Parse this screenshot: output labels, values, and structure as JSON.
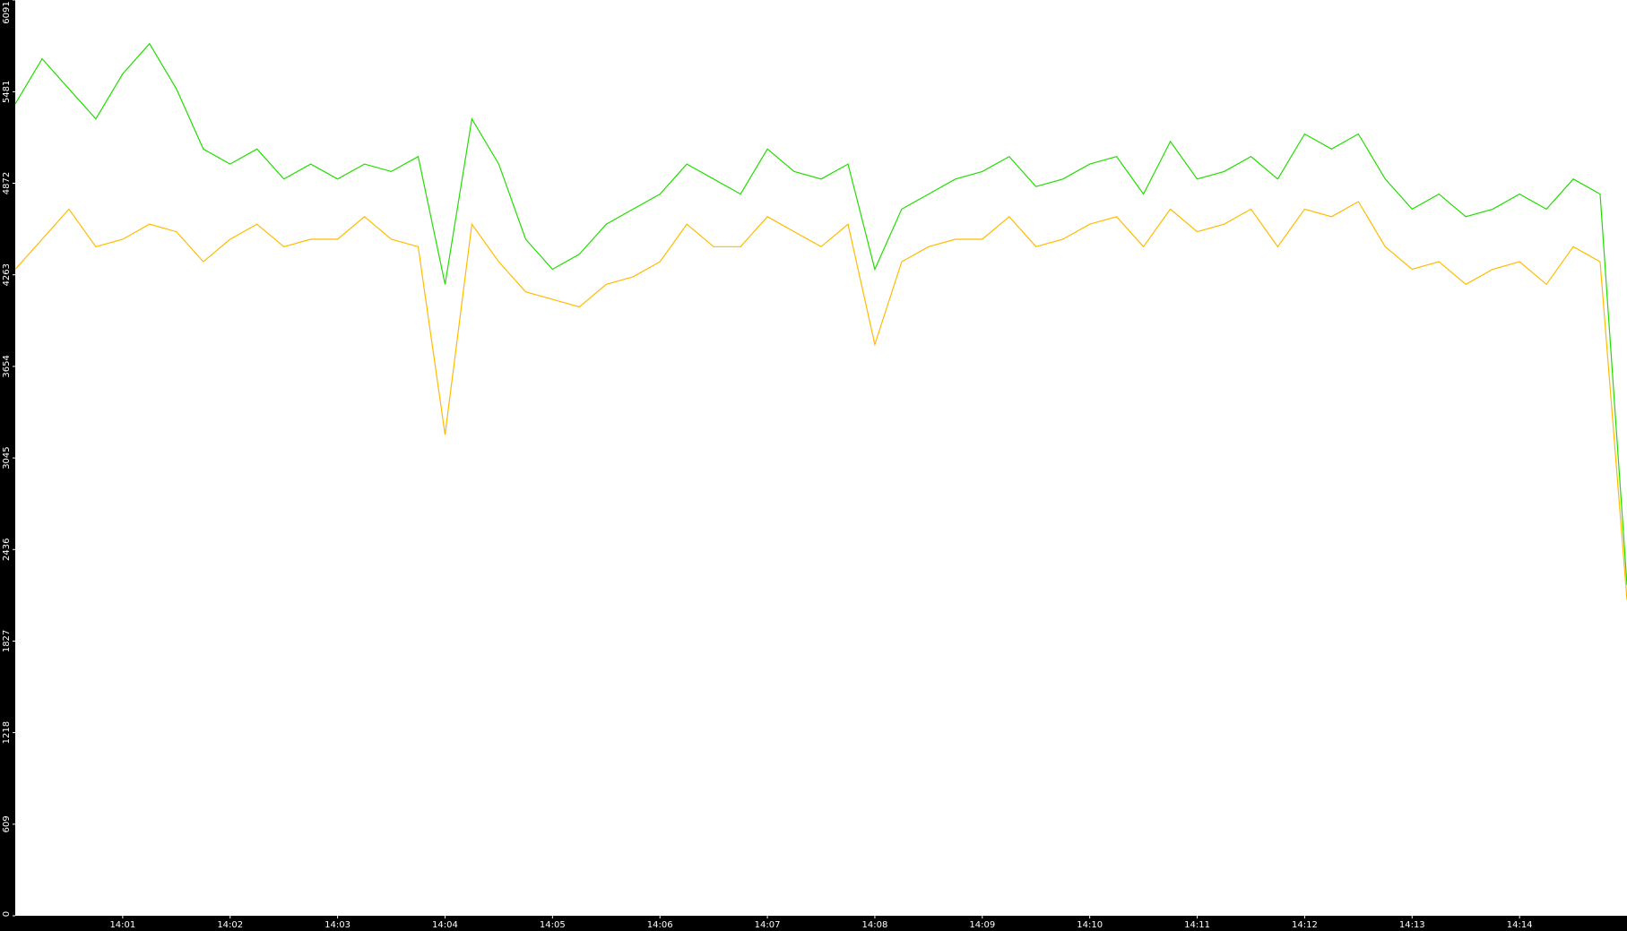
{
  "chart_data": {
    "type": "line",
    "title": "",
    "xlabel": "",
    "ylabel": "",
    "grid": false,
    "legend": "none",
    "ylim": [
      0,
      6091
    ],
    "xlim": [
      "14:00:00",
      "14:15:00"
    ],
    "y_ticks": [
      "0",
      "609",
      "1218",
      "1827",
      "2436",
      "3045",
      "3654",
      "4263",
      "4872",
      "5481",
      "6091"
    ],
    "x_ticks": [
      {
        "time": "14:01",
        "label": "14:01"
      },
      {
        "time": "14:02",
        "label": "14:02"
      },
      {
        "time": "14:03",
        "label": "14:03"
      },
      {
        "time": "14:04",
        "label": "14:04"
      },
      {
        "time": "14:05",
        "label": "14:05"
      },
      {
        "time": "14:06",
        "label": "14:06"
      },
      {
        "time": "14:07",
        "label": "14:07"
      },
      {
        "time": "14:08",
        "label": "14:08"
      },
      {
        "time": "14:09",
        "label": "14:09"
      },
      {
        "time": "14:10",
        "label": "14:10"
      },
      {
        "time": "14:11",
        "label": "14:11"
      },
      {
        "time": "14:12",
        "label": "14:12"
      },
      {
        "time": "14:13",
        "label": "14:13"
      },
      {
        "time": "14:14",
        "label": "14:14"
      }
    ],
    "colors": {
      "plot_background": "#ffffff",
      "frame_background": "#000000",
      "tick_text": "#ffffff"
    },
    "series": [
      {
        "color": "#22dd00",
        "x": [
          "14:00:00",
          "14:00:15",
          "14:00:30",
          "14:00:45",
          "14:01:00",
          "14:01:15",
          "14:01:30",
          "14:01:45",
          "14:02:00",
          "14:02:15",
          "14:02:30",
          "14:02:45",
          "14:03:00",
          "14:03:15",
          "14:03:30",
          "14:03:45",
          "14:04:00",
          "14:04:15",
          "14:04:30",
          "14:04:45",
          "14:05:00",
          "14:05:15",
          "14:05:30",
          "14:05:45",
          "14:06:00",
          "14:06:15",
          "14:06:30",
          "14:06:45",
          "14:07:00",
          "14:07:15",
          "14:07:30",
          "14:07:45",
          "14:08:00",
          "14:08:15",
          "14:08:30",
          "14:08:45",
          "14:09:00",
          "14:09:15",
          "14:09:30",
          "14:09:45",
          "14:10:00",
          "14:10:15",
          "14:10:30",
          "14:10:45",
          "14:11:00",
          "14:11:15",
          "14:11:30",
          "14:11:45",
          "14:12:00",
          "14:12:15",
          "14:12:30",
          "14:12:45",
          "14:13:00",
          "14:13:15",
          "14:13:30",
          "14:13:45",
          "14:14:00",
          "14:14:15",
          "14:14:30",
          "14:14:45",
          "14:15:00"
        ],
        "y": [
          5400,
          5700,
          5500,
          5300,
          5600,
          5800,
          5500,
          5100,
          5000,
          5100,
          4900,
          5000,
          4900,
          5000,
          4950,
          5050,
          4200,
          5300,
          5000,
          4500,
          4300,
          4400,
          4600,
          4700,
          4800,
          5000,
          4900,
          4800,
          5100,
          4950,
          4900,
          5000,
          4300,
          4700,
          4800,
          4900,
          4950,
          5050,
          4850,
          4900,
          5000,
          5050,
          4800,
          5150,
          4900,
          4950,
          5050,
          4900,
          5200,
          5100,
          5200,
          4900,
          4700,
          4800,
          4650,
          4700,
          4800,
          4700,
          4900,
          4800,
          2200
        ]
      },
      {
        "color": "#ffbb00",
        "x": [
          "14:00:00",
          "14:00:15",
          "14:00:30",
          "14:00:45",
          "14:01:00",
          "14:01:15",
          "14:01:30",
          "14:01:45",
          "14:02:00",
          "14:02:15",
          "14:02:30",
          "14:02:45",
          "14:03:00",
          "14:03:15",
          "14:03:30",
          "14:03:45",
          "14:04:00",
          "14:04:15",
          "14:04:30",
          "14:04:45",
          "14:05:00",
          "14:05:15",
          "14:05:30",
          "14:05:45",
          "14:06:00",
          "14:06:15",
          "14:06:30",
          "14:06:45",
          "14:07:00",
          "14:07:15",
          "14:07:30",
          "14:07:45",
          "14:08:00",
          "14:08:15",
          "14:08:30",
          "14:08:45",
          "14:09:00",
          "14:09:15",
          "14:09:30",
          "14:09:45",
          "14:10:00",
          "14:10:15",
          "14:10:30",
          "14:10:45",
          "14:11:00",
          "14:11:15",
          "14:11:30",
          "14:11:45",
          "14:12:00",
          "14:12:15",
          "14:12:30",
          "14:12:45",
          "14:13:00",
          "14:13:15",
          "14:13:30",
          "14:13:45",
          "14:14:00",
          "14:14:15",
          "14:14:30",
          "14:14:45",
          "14:15:00"
        ],
        "y": [
          4300,
          4500,
          4700,
          4450,
          4500,
          4600,
          4550,
          4350,
          4500,
          4600,
          4450,
          4500,
          4500,
          4650,
          4500,
          4450,
          3200,
          4600,
          4350,
          4150,
          4100,
          4050,
          4200,
          4250,
          4350,
          4600,
          4450,
          4450,
          4650,
          4550,
          4450,
          4600,
          3800,
          4350,
          4450,
          4500,
          4500,
          4650,
          4450,
          4500,
          4600,
          4650,
          4450,
          4700,
          4550,
          4600,
          4700,
          4450,
          4700,
          4650,
          4750,
          4450,
          4300,
          4350,
          4200,
          4300,
          4350,
          4200,
          4450,
          4350,
          2100
        ]
      }
    ]
  }
}
